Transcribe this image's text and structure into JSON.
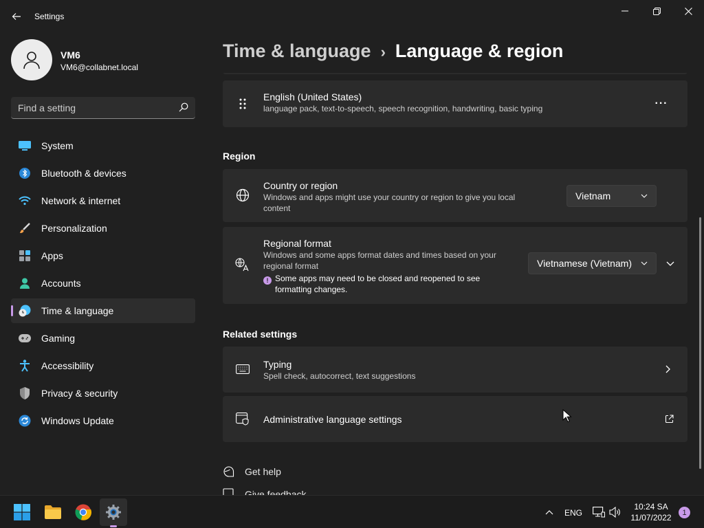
{
  "window": {
    "app_title": "Settings"
  },
  "user": {
    "name": "VM6",
    "email": "VM6@collabnet.local"
  },
  "search": {
    "placeholder": "Find a setting"
  },
  "sidebar": {
    "items": [
      {
        "label": "System",
        "icon": "monitor-icon",
        "active": false
      },
      {
        "label": "Bluetooth & devices",
        "icon": "bluetooth-icon",
        "active": false
      },
      {
        "label": "Network & internet",
        "icon": "wifi-icon",
        "active": false
      },
      {
        "label": "Personalization",
        "icon": "brush-icon",
        "active": false
      },
      {
        "label": "Apps",
        "icon": "apps-icon",
        "active": false
      },
      {
        "label": "Accounts",
        "icon": "person-icon",
        "active": false
      },
      {
        "label": "Time & language",
        "icon": "clock-globe-icon",
        "active": true
      },
      {
        "label": "Gaming",
        "icon": "gamepad-icon",
        "active": false
      },
      {
        "label": "Accessibility",
        "icon": "accessibility-icon",
        "active": false
      },
      {
        "label": "Privacy & security",
        "icon": "shield-icon",
        "active": false
      },
      {
        "label": "Windows Update",
        "icon": "update-icon",
        "active": false
      }
    ]
  },
  "breadcrumb": {
    "parent": "Time & language",
    "separator": "›",
    "current": "Language & region"
  },
  "language_card": {
    "title": "English (United States)",
    "description": "language pack, text-to-speech, speech recognition, handwriting, basic typing",
    "more_label": "···"
  },
  "region": {
    "heading": "Region",
    "country": {
      "title": "Country or region",
      "description": "Windows and apps might use your country or region to give you local content",
      "value": "Vietnam"
    },
    "format": {
      "title": "Regional format",
      "description": "Windows and some apps format dates and times based on your regional format",
      "value": "Vietnamese (Vietnam)",
      "warning": "Some apps may need to be closed and reopened to see formatting changes.",
      "warning_icon": "!"
    }
  },
  "related": {
    "heading": "Related settings",
    "typing": {
      "title": "Typing",
      "description": "Spell check, autocorrect, text suggestions"
    },
    "admin": {
      "title": "Administrative language settings"
    }
  },
  "links": {
    "help": "Get help",
    "feedback": "Give feedback"
  },
  "taskbar": {
    "language": "ENG",
    "time": "10:24 SA",
    "date": "11/07/2022",
    "notifications": "1"
  },
  "colors": {
    "accent": "#c89ae8",
    "background": "#202020",
    "card": "#2b2b2b"
  }
}
